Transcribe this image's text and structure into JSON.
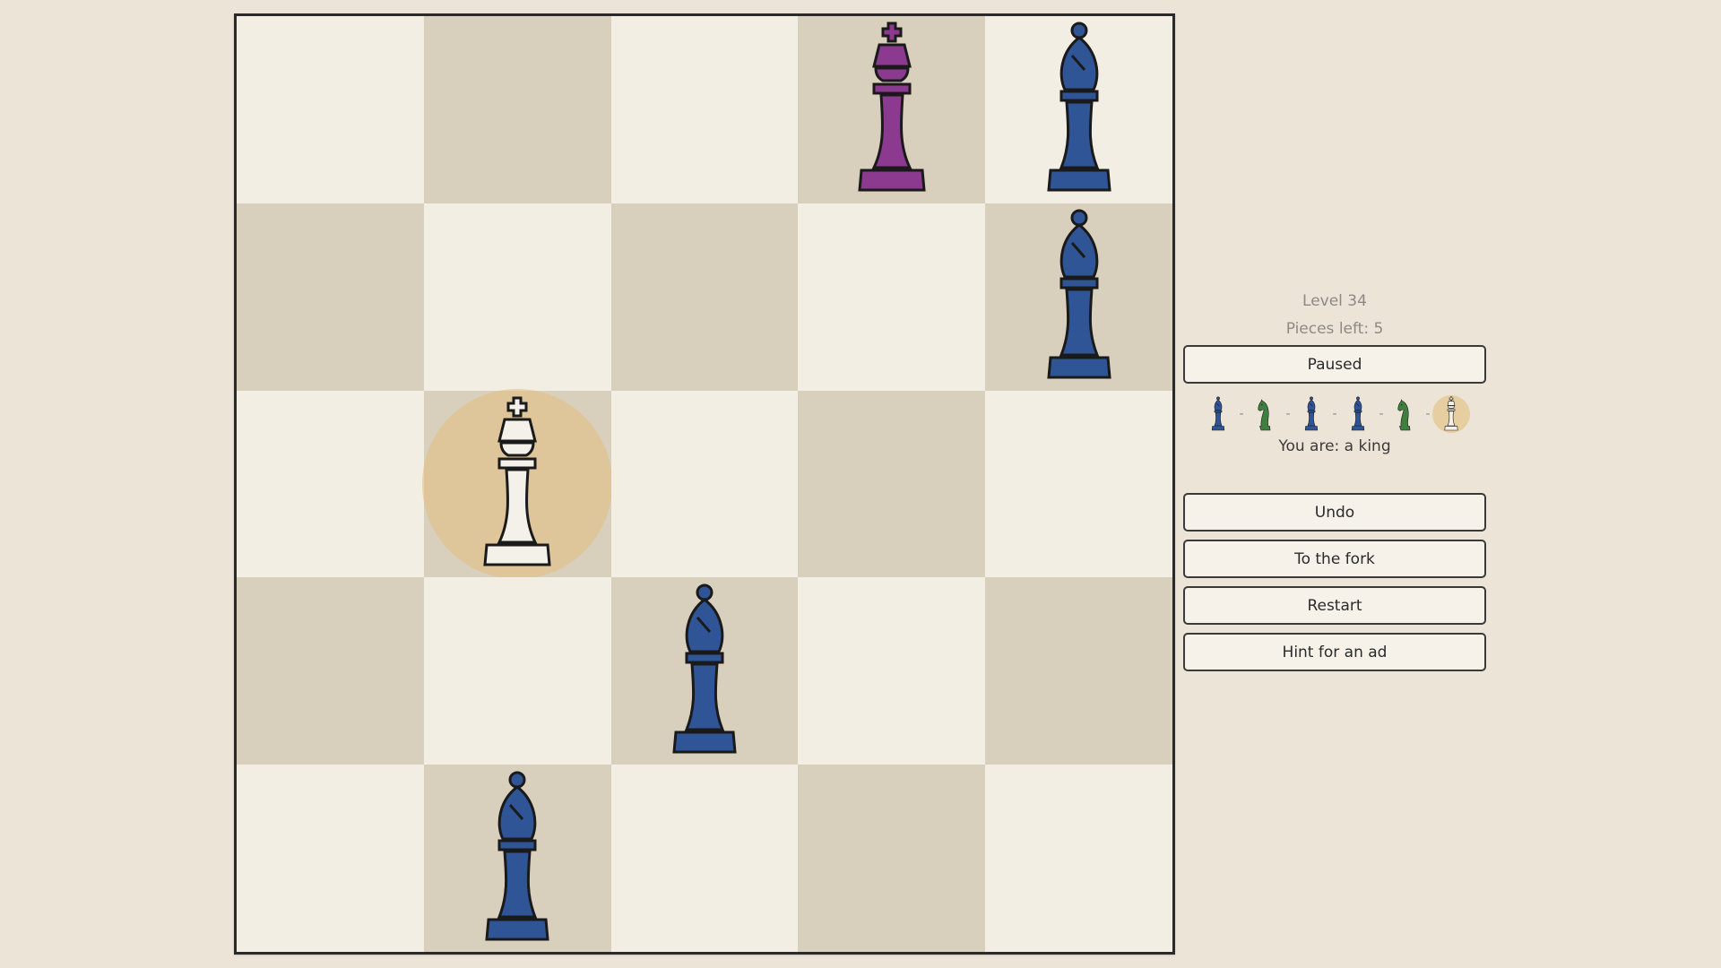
{
  "board": {
    "size": 5,
    "colors": {
      "light": "#f3eee4",
      "dark": "#d9cfbd",
      "highlight": "#e2be7d"
    },
    "pieces": [
      {
        "row": 0,
        "col": 3,
        "type": "king",
        "color": "#8b3a8f",
        "name": "enemy-king"
      },
      {
        "row": 0,
        "col": 4,
        "type": "bishop",
        "color": "#2f5597",
        "name": "bishop"
      },
      {
        "row": 1,
        "col": 4,
        "type": "bishop",
        "color": "#2f5597",
        "name": "bishop"
      },
      {
        "row": 2,
        "col": 1,
        "type": "king",
        "color": "#f4f1ea",
        "name": "player-king",
        "selected": true
      },
      {
        "row": 3,
        "col": 2,
        "type": "bishop",
        "color": "#2f5597",
        "name": "bishop"
      },
      {
        "row": 4,
        "col": 1,
        "type": "bishop",
        "color": "#2f5597",
        "name": "bishop"
      }
    ]
  },
  "panel": {
    "level": "Level 34",
    "pieces_left": "Pieces left: 5",
    "paused_label": "Paused",
    "sequence": [
      {
        "type": "bishop",
        "color": "#2f5597",
        "icon": "bishop-icon"
      },
      {
        "type": "knight",
        "color": "#3f7f3f",
        "icon": "knight-icon"
      },
      {
        "type": "bishop",
        "color": "#2f5597",
        "icon": "bishop-icon"
      },
      {
        "type": "bishop",
        "color": "#2f5597",
        "icon": "bishop-icon"
      },
      {
        "type": "knight",
        "color": "#3f7f3f",
        "icon": "knight-icon"
      },
      {
        "type": "king",
        "color": "#f4f1ea",
        "icon": "king-icon",
        "current": true
      }
    ],
    "you_are": "You are: a king",
    "buttons": {
      "undo": "Undo",
      "to_fork": "To the fork",
      "restart": "Restart",
      "hint": "Hint for an ad"
    }
  }
}
